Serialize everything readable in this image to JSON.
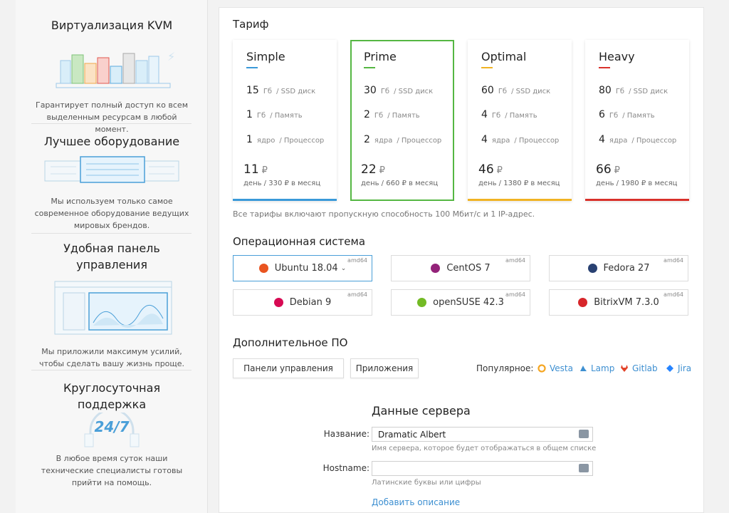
{
  "sidebar": {
    "features": [
      {
        "title": "Виртуализация KVM",
        "desc": "Гарантирует полный доступ ко всем выделенным ресурсам в любой момент."
      },
      {
        "title": "Лучшее оборудование",
        "desc": "Мы используем только самое современное оборудование ведущих мировых брендов."
      },
      {
        "title": "Удобная панель управления",
        "desc": "Мы приложили максимум усилий, чтобы сделать вашу жизнь проще."
      },
      {
        "title": "Круглосуточная поддержка",
        "badge": "24/7",
        "desc": "В любое время суток наши технические специалисты готовы прийти на помощь."
      }
    ]
  },
  "tariff": {
    "title": "Тариф",
    "plans": [
      {
        "name": "Simple",
        "color": "#3a9ad9",
        "ssd": "15",
        "ram": "1",
        "cpu": "1",
        "price": "11",
        "period": "день / 330 ₽ в месяц",
        "selected": false
      },
      {
        "name": "Prime",
        "color": "#55b743",
        "ssd": "30",
        "ram": "2",
        "cpu": "2",
        "price": "22",
        "period": "день / 660 ₽ в месяц",
        "selected": true
      },
      {
        "name": "Optimal",
        "color": "#f0b323",
        "ssd": "60",
        "ram": "4",
        "cpu": "4",
        "price": "46",
        "period": "день / 1380 ₽ в месяц",
        "selected": false
      },
      {
        "name": "Heavy",
        "color": "#d9312b",
        "ssd": "80",
        "ram": "6",
        "cpu": "4",
        "price": "66",
        "period": "день / 1980 ₽ в месяц",
        "selected": false
      }
    ],
    "labels": {
      "gb": "Гб",
      "core": "ядро",
      "cores": "ядра",
      "ssd": "/ SSD диск",
      "ram": "/ Память",
      "cpu": "/ Процессор",
      "currency": "₽"
    },
    "note": "Все тарифы включают пропускную способность 100 Мбит/с и 1 IP-адрес."
  },
  "os": {
    "title": "Операционная система",
    "arch": "amd64",
    "items": [
      {
        "name": "Ubuntu 18.04",
        "icon": "ubuntu-icon",
        "color": "#e95420",
        "selected": true,
        "chevron": "⌄"
      },
      {
        "name": "CentOS 7",
        "icon": "centos-icon",
        "color": "#932279",
        "selected": false
      },
      {
        "name": "Fedora 27",
        "icon": "fedora-icon",
        "color": "#294172",
        "selected": false
      },
      {
        "name": "Debian 9",
        "icon": "debian-icon",
        "color": "#d70a53",
        "selected": false
      },
      {
        "name": "openSUSE 42.3",
        "icon": "opensuse-icon",
        "color": "#73ba25",
        "selected": false
      },
      {
        "name": "BitrixVM 7.3.0",
        "icon": "bitrix-icon",
        "color": "#d7262a",
        "selected": false
      }
    ]
  },
  "software": {
    "title": "Дополнительное ПО",
    "buttons": [
      "Панели управления",
      "Приложения"
    ],
    "popular_label": "Популярное:",
    "popular": [
      {
        "name": "Vesta",
        "icon": "vesta-icon",
        "color": "#f5a623"
      },
      {
        "name": "Lamp",
        "icon": "lamp-icon",
        "color": "#3d8fd1"
      },
      {
        "name": "Gitlab",
        "icon": "gitlab-icon",
        "color": "#e24329"
      },
      {
        "name": "Jira",
        "icon": "jira-icon",
        "color": "#2684ff"
      }
    ]
  },
  "server": {
    "title": "Данные сервера",
    "name_label": "Название:",
    "name_value": "Dramatic Albert",
    "name_hint": "Имя сервера, которое будет отображаться в общем списке",
    "hostname_label": "Hostname:",
    "hostname_value": "",
    "hostname_hint": "Латинские буквы или цифры",
    "add_description": "Добавить описание"
  }
}
